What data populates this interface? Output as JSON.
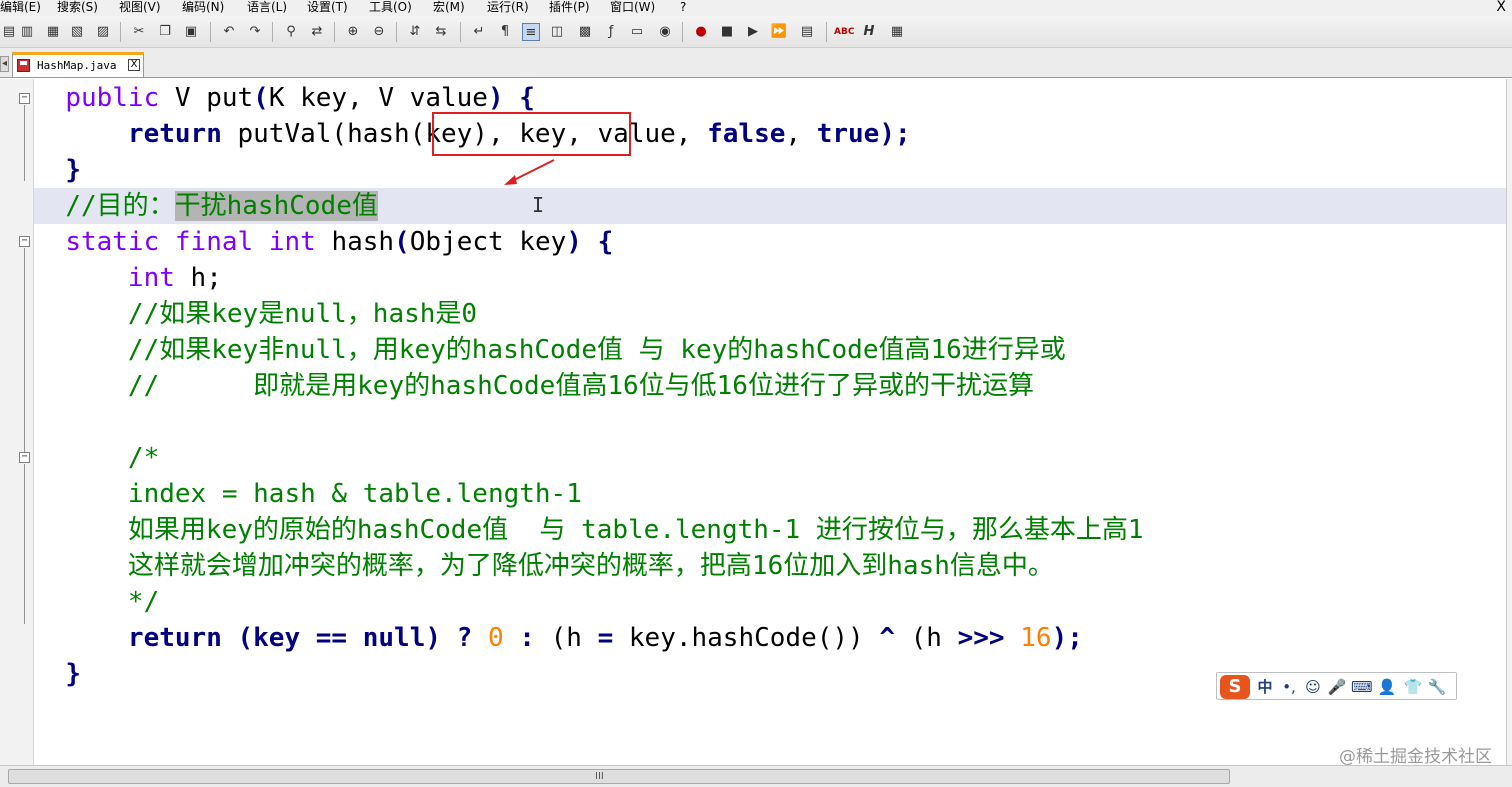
{
  "menu": [
    "编辑(E)",
    "搜索(S)",
    "视图(V)",
    "编码(N)",
    "语言(L)",
    "设置(T)",
    "工具(O)",
    "宏(M)",
    "运行(R)",
    "插件(P)",
    "窗口(W)",
    "?"
  ],
  "window_close": "X",
  "toolbar_icons": [
    "new-file-icon",
    "open-icon",
    "save-icon",
    "save-all-icon",
    "close-icon",
    "print-icon",
    "cut-icon",
    "copy-icon",
    "paste-icon",
    "undo-icon",
    "redo-icon",
    "find-icon",
    "replace-icon",
    "zoom-in-icon",
    "zoom-out-icon",
    "sync-vertical-icon",
    "sync-horizontal-icon",
    "word-wrap-icon",
    "show-all-chars-icon",
    "indent-guide-icon",
    "user-lang-icon",
    "doc-map-icon",
    "function-list-icon",
    "folder-workspace-icon",
    "monitor-icon",
    "record-macro-icon",
    "stop-macro-icon",
    "play-macro-icon",
    "run-macro-multiple-icon",
    "save-macro-icon",
    "spell-check-icon",
    "h-icon",
    "plugin-icon"
  ],
  "tab": {
    "filename": "HashMap.java",
    "close": "X"
  },
  "code": {
    "l1": {
      "kw": "public",
      "rest1": " V put",
      "p1": "(",
      "rest2": "K key, V value",
      "p2": ")",
      "sp": " ",
      "brace": "{"
    },
    "l2": {
      "kw": "return",
      "rest1": " putVal",
      "boxed": "(hash(key),",
      "rest2": " key, value, ",
      "false": "false",
      "comma": ", ",
      "true": "true",
      "end": ");"
    },
    "l3": "}",
    "l4": {
      "comment": "//目的：",
      "selected": "干扰hashCode值"
    },
    "l5": {
      "kw1": "static",
      "kw2": "final",
      "ty": "int",
      "rest": " hash",
      "p1": "(",
      "args": "Object key",
      "p2": ")",
      "brace": "{"
    },
    "l6": {
      "ty": "int",
      "rest": " h;"
    },
    "l7": "//如果key是null，hash是0",
    "l8": "//如果key非null，用key的hashCode值 与 key的hashCode值高16进行异或",
    "l9": "//      即就是用key的hashCode值高16位与低16位进行了异或的干扰运算",
    "l10": "/*",
    "l11": "index = hash & table.length-1",
    "l12": "如果用key的原始的hashCode值  与 table.length-1 进行按位与，那么基本上高1",
    "l13": "这样就会增加冲突的概率，为了降低冲突的概率，把高16位加入到hash信息中。",
    "l14": "*/",
    "l15": {
      "kw": "return",
      "a": " (key ",
      "eq": "==",
      "sp": " ",
      "null": "null",
      "b": ") ",
      "q": "?",
      "c": " ",
      "zero": "0",
      "d": " ",
      "colon": ":",
      "e": " (h ",
      "assign": "=",
      "f": " key.hashCode()) ",
      "xor": "^",
      "g": " (h ",
      "shift": ">>>",
      "h": " ",
      "sixteen": "16",
      "i": ");"
    },
    "l16": "}"
  },
  "ime": {
    "logo": "S",
    "mode": "中",
    "punct": "•,",
    "emoji": "☺",
    "voice": "🎤",
    "keyboard": "⌨",
    "skin": "👕",
    "tools": "🔧",
    "user": "👤"
  },
  "scroll_grip": "III",
  "watermark": "@稀土掘金技术社区",
  "colors": {
    "keyword": "#000080",
    "type": "#8000ff",
    "comment": "#008000",
    "number": "#ff8000",
    "annotation": "#e02020",
    "current_line": "#e3e5f3"
  }
}
